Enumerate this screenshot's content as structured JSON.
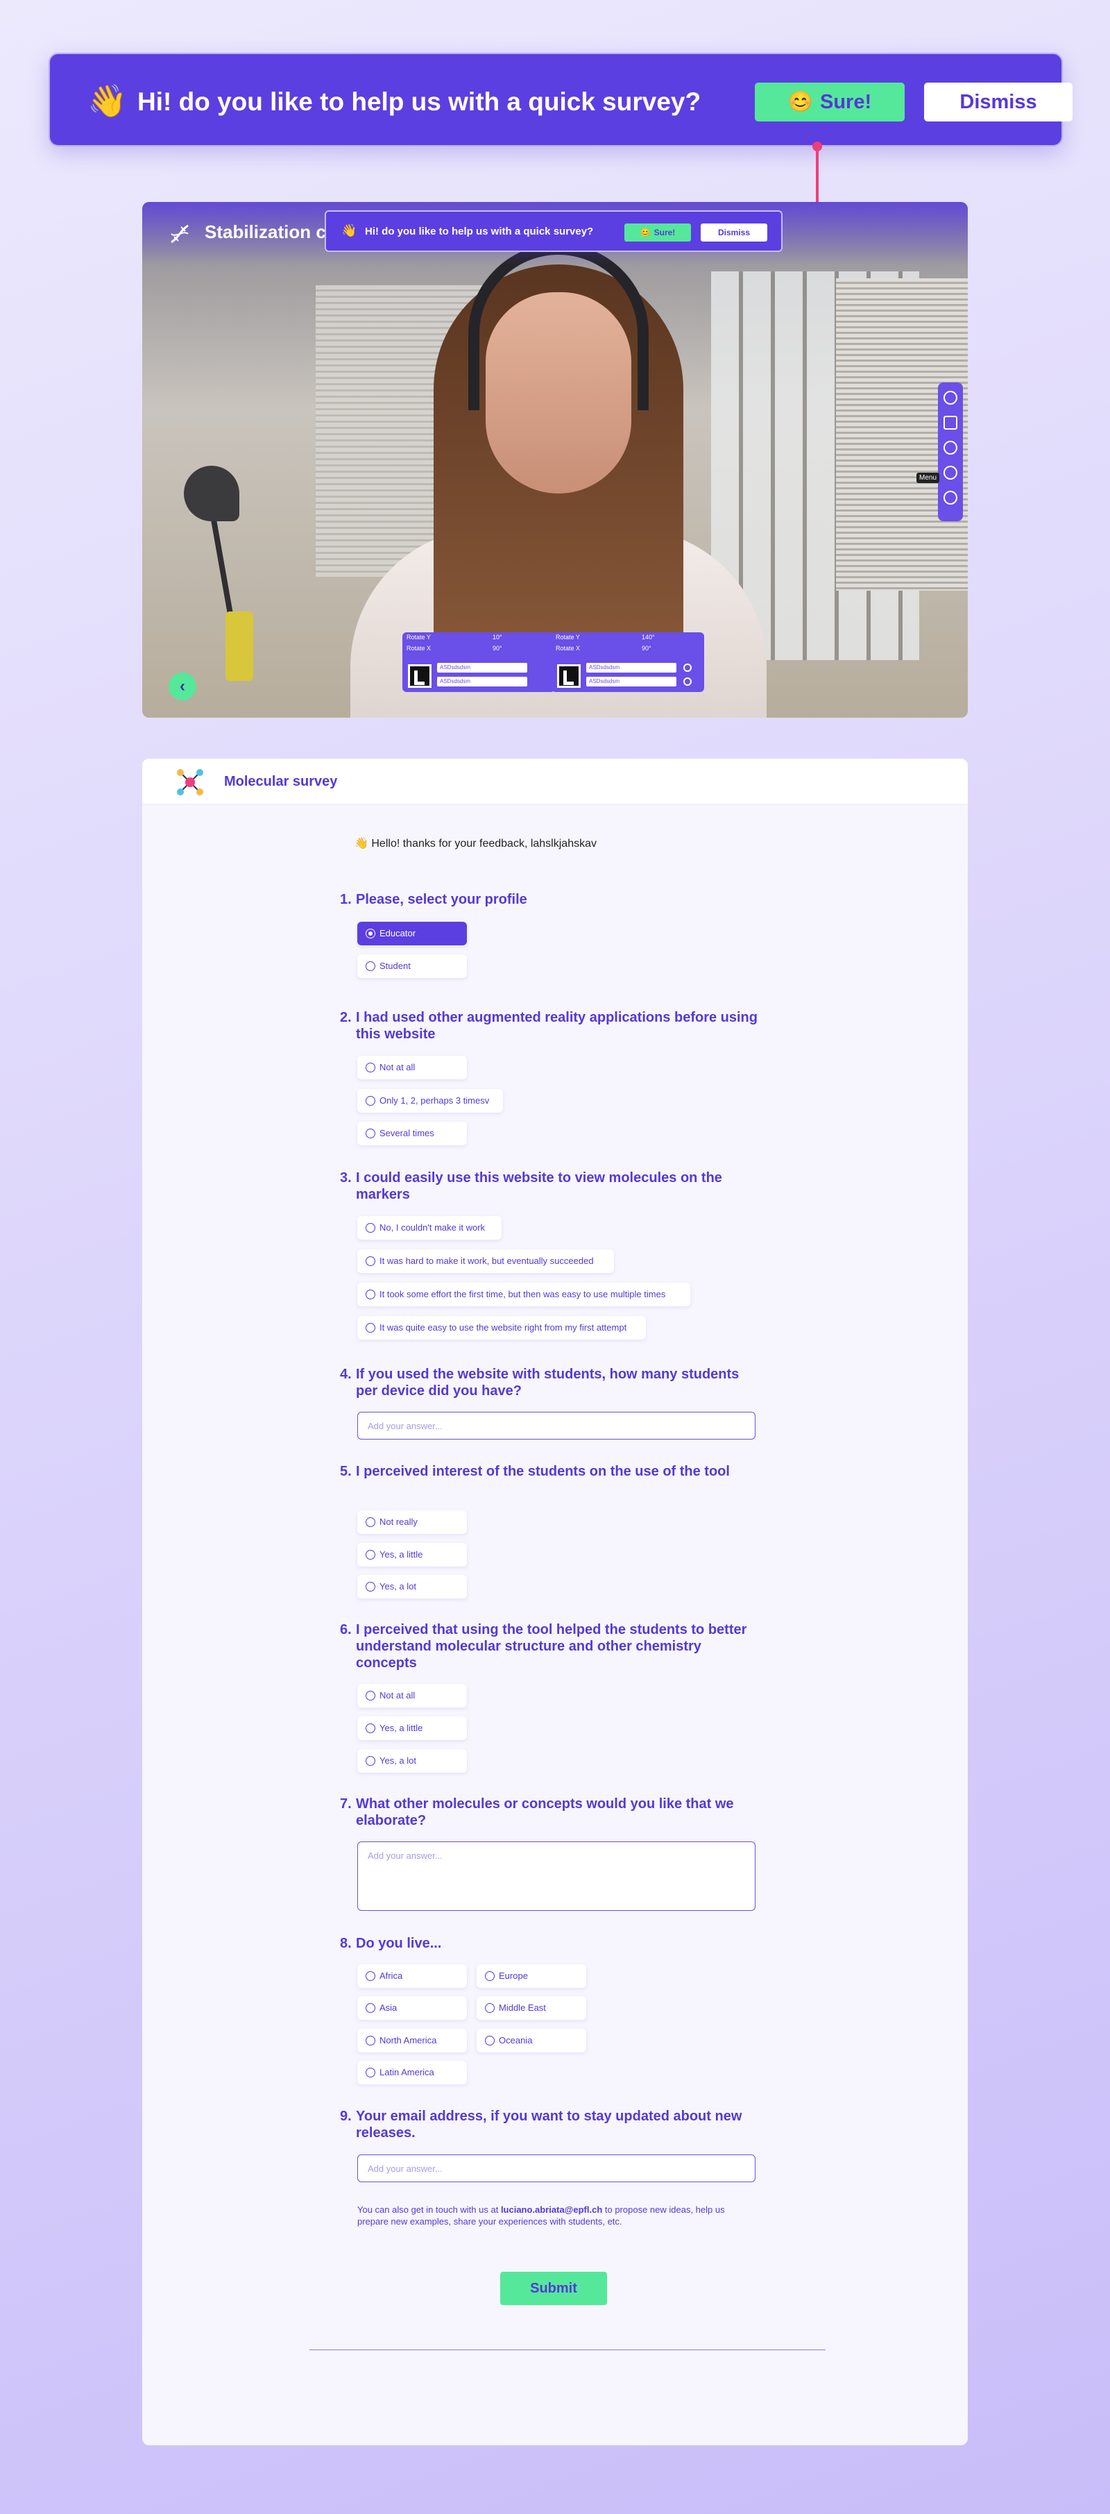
{
  "banner": {
    "wave": "👋",
    "message": "Hi! do you like to  help us with a quick survey?",
    "sure_emoji": "😊",
    "sure_label": "Sure!",
    "dismiss_label": "Dismiss"
  },
  "video": {
    "app_title": "Stabilization c",
    "menu_tooltip": "Menu",
    "controls": [
      {
        "rotate_y_label": "Rotate Y",
        "rotate_y_value": "10°",
        "rotate_x_label": "Rotate X",
        "rotate_x_value": "90°",
        "select1": "ASDsdsdsm",
        "select2": "ASDsdsdsm"
      },
      {
        "rotate_y_label": "Rotate Y",
        "rotate_y_value": "140°",
        "rotate_x_label": "Rotate X",
        "rotate_x_value": "90°",
        "select1": "ASDsdsdsm",
        "select2": "ASDsdsdsm"
      }
    ]
  },
  "survey": {
    "title": "Molecular survey",
    "greeting_emoji": "👋",
    "greeting": "Hello! thanks for your feedback, lahslkjahskav",
    "q1": {
      "num": "1.",
      "text": "Please, select your profile",
      "options": [
        "Educator",
        "Student"
      ],
      "selected": "Educator"
    },
    "q2": {
      "num": "2.",
      "text": "I had used other augmented reality applications before using this website",
      "options": [
        "Not at all",
        "Only 1, 2, perhaps 3 timesv",
        "Several times"
      ]
    },
    "q3": {
      "num": "3.",
      "text": "I could easily use this website to view molecules on the markers",
      "options": [
        "No, I couldn't make it work",
        "It was hard to make it work, but eventually succeeded",
        "It took some effort the first time, but then was easy to use multiple times",
        "It was quite easy to use the website right from my first attempt"
      ]
    },
    "q4": {
      "num": "4.",
      "text": "If you used the website with students, how many students per device did you have?",
      "placeholder": "Add your answer..."
    },
    "q5": {
      "num": "5.",
      "text": "I perceived interest of the students on the use of the tool",
      "options": [
        "Not really",
        "Yes, a little",
        "Yes, a lot"
      ]
    },
    "q6": {
      "num": "6.",
      "text": "I perceived that using the tool helped the students to better understand molecular structure and other chemistry concepts",
      "options": [
        "Not at all",
        "Yes, a little",
        "Yes, a lot"
      ]
    },
    "q7": {
      "num": "7.",
      "text": "What other molecules or concepts would you like that we elaborate?",
      "placeholder": "Add your answer..."
    },
    "q8": {
      "num": "8.",
      "text": "Do you live...",
      "options": [
        "Africa",
        "Europe",
        "Asia",
        "Middle East",
        "North America",
        "Oceania",
        "Latin America"
      ]
    },
    "q9": {
      "num": "9.",
      "text": "Your email address, if you want to stay updated about new releases.",
      "placeholder": "Add your answer..."
    },
    "note_prefix": "You can also get in touch with us at ",
    "note_email": "luciano.abriata@epfl.ch",
    "note_suffix": " to propose new ideas, help us prepare new examples, share your experiences with students, etc.",
    "submit_label": "Submit"
  },
  "colors": {
    "accent": "#5b3fe0",
    "button_green": "#55e89a",
    "connector": "#ef3e7a"
  }
}
